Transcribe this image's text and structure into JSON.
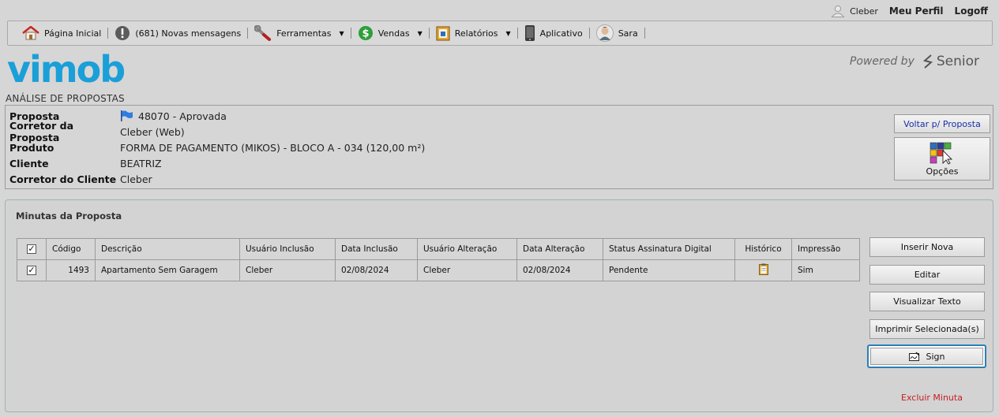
{
  "top_user": {
    "user_name": "Cleber",
    "profile_link": "Meu Perfil",
    "logoff_link": "Logoff"
  },
  "menu": {
    "home": "Página Inicial",
    "messages": "(681) Novas mensagens",
    "tools": "Ferramentas",
    "sales": "Vendas",
    "reports": "Relatórios",
    "app": "Aplicativo",
    "assistant": "Sara"
  },
  "brand": {
    "logo_text": "vimob",
    "powered_by": "Powered by",
    "partner": "Senior"
  },
  "page_title": "ANÁLISE DE PROPOSTAS",
  "proposal": {
    "rows": [
      {
        "label": "Proposta",
        "value": "48070 - Aprovada"
      },
      {
        "label": "Corretor da Proposta",
        "value": "Cleber (Web)"
      },
      {
        "label": "Produto",
        "value": "FORMA DE PAGAMENTO (MIKOS) - BLOCO A - 034 (120,00 m²)"
      },
      {
        "label": "Cliente",
        "value": "BEATRIZ"
      },
      {
        "label": "Corretor do Cliente",
        "value": "Cleber"
      }
    ],
    "back_button": "Voltar p/ Proposta",
    "options_button": "Opções"
  },
  "minutas": {
    "title": "Minutas da Proposta",
    "columns": [
      "Código",
      "Descrição",
      "Usuário Inclusão",
      "Data Inclusão",
      "Usuário Alteração",
      "Data Alteração",
      "Status Assinatura Digital",
      "Histórico",
      "Impressão"
    ],
    "rows": [
      {
        "code": "1493",
        "description": "Apartamento Sem Garagem",
        "user_inclusion": "Cleber",
        "date_inclusion": "02/08/2024",
        "user_change": "Cleber",
        "date_change": "02/08/2024",
        "signature_status": "Pendente",
        "printing": "Sim"
      }
    ],
    "buttons": {
      "insert": "Inserir Nova",
      "edit": "Editar",
      "view_text": "Visualizar Texto",
      "print_selected": "Imprimir Selecionada(s)",
      "sign": "Sign",
      "delete": "Excluir Minuta"
    }
  },
  "colors": {
    "brand": "#1a9fd8",
    "delete": "#c81e1e",
    "link": "#1a2fa8",
    "focus": "#2a7fb5"
  }
}
